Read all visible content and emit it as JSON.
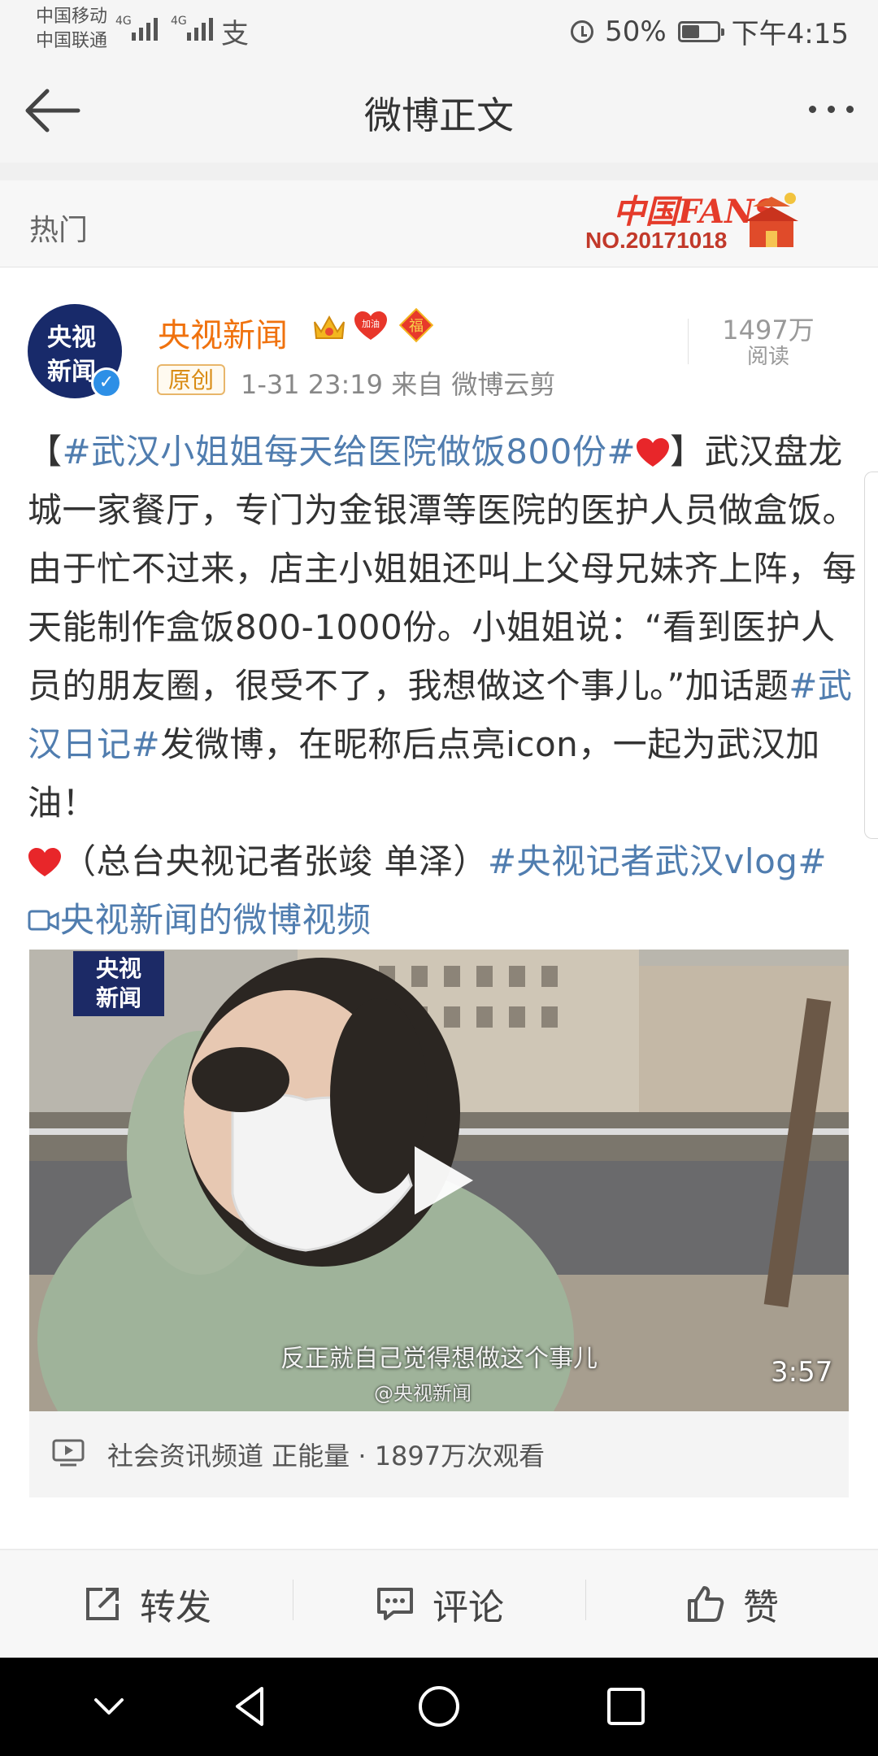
{
  "status_bar": {
    "carrier_1": "中国移动",
    "carrier_2": "中国联通",
    "signal_1_label": "4G",
    "signal_2_label": "4G",
    "wifi_glyph": "支",
    "battery_percent": "50%",
    "battery_level": 0.5,
    "time": "下午4:15"
  },
  "nav": {
    "title": "微博正文"
  },
  "hot_row": {
    "label": "热门",
    "fans_badge_title": "中国FANS",
    "fans_badge_number": "NO.20171018"
  },
  "post": {
    "avatar_line1": "央视",
    "avatar_line2": "新闻",
    "author": "央视新闻",
    "badge_jiayou": "加油",
    "badge_fu": "福",
    "original_tag": "原创",
    "meta": "1-31 23:19   来自 微博云剪",
    "read_count": "1497万",
    "read_label": "阅读",
    "text": {
      "open_bracket": "【",
      "topic_1": "#武汉小姐姐每天给医院做饭800份#",
      "part_1": "】武汉盘龙城一家餐厅，专门为金银潭等医院的医护人员做盒饭。由于忙不过来，店主小姐姐还叫上父母兄妹齐上阵，每天能制作盒饭800-1000份。小姐姐说：“看到医护人员的朋友圈，很受不了，我想做这个事儿。”加话题",
      "topic_2": "#武汉日记#",
      "part_2": "发微博，在昵称后点亮icon，一起为武汉加油！",
      "part_3": "（总台央视记者张竣 单泽）",
      "topic_3": "#央视记者武汉vlog#",
      "video_link": "央视新闻的微博视频"
    }
  },
  "video": {
    "logo_line1": "央视",
    "logo_line2": "新闻",
    "subtitle": "反正就自己觉得想做这个事儿",
    "watermark": "@央视新闻",
    "duration": "3:57",
    "info": "社会资讯频道 正能量 · 1897万次观看"
  },
  "actions": {
    "repost": "转发",
    "comment": "评论",
    "like": "赞"
  },
  "colors": {
    "link": "#507daf",
    "author": "#f0720e",
    "background": "#ffffff"
  },
  "icons": [
    "back-arrow-icon",
    "more-icon",
    "alarm-icon",
    "battery-icon",
    "crown-icon",
    "jiayou-heart-icon",
    "fu-icon",
    "heart-icon",
    "play-icon",
    "video-channel-icon",
    "repost-icon",
    "comment-icon",
    "like-icon",
    "chevron-down-icon",
    "back-triangle-icon",
    "home-circle-icon",
    "recents-square-icon"
  ]
}
